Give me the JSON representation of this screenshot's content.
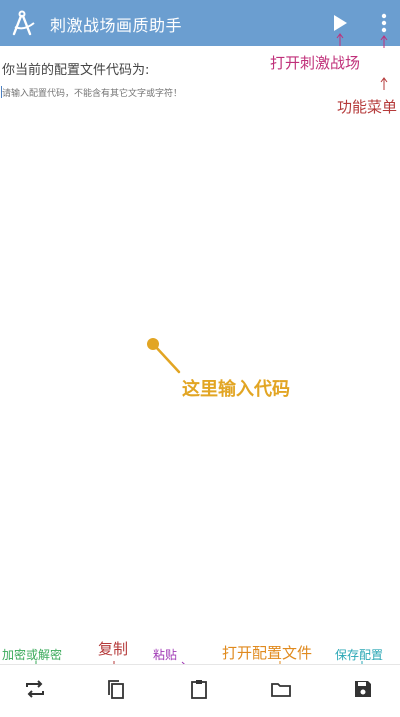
{
  "app": {
    "title": "刺激战场画质助手"
  },
  "main": {
    "current_label": "你当前的配置文件代码为:",
    "input_placeholder": "请输入配置代码，不能含有其它文字或字符！",
    "center_note": "这里输入代码"
  },
  "annotations": {
    "open_game": "打开刺激战场",
    "function_menu": "功能菜单",
    "encrypt_decrypt": "加密或解密",
    "copy": "复制",
    "paste": "粘贴",
    "open_config": "打开配置文件",
    "save_config": "保存配置"
  },
  "icons": {
    "app": "compass-icon",
    "play": "play-icon",
    "more": "more-vert-icon",
    "swap": "swap-icon",
    "copy": "copy-icon",
    "paste": "clipboard-icon",
    "folder": "folder-icon",
    "save": "save-icon"
  },
  "colors": {
    "appbar": "#6b9ed0",
    "annot_magenta": "#c0307a",
    "annot_red": "#b53a3a",
    "annot_green": "#3aaa5a",
    "annot_purple": "#a03ab5",
    "annot_orange": "#e08a1e",
    "annot_teal": "#2aa7b5",
    "center_note": "#e2a523"
  }
}
